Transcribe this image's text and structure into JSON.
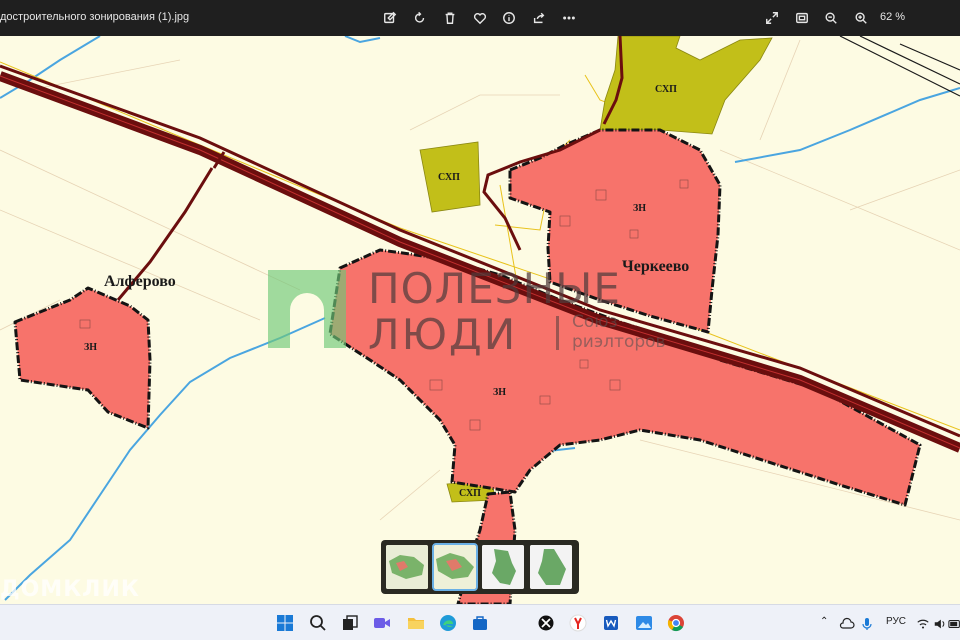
{
  "window": {
    "title": "достроительного зонирования (1).jpg",
    "zoom_level": "62 %"
  },
  "toolbar": {
    "icons": [
      "edit-icon",
      "rotate-icon",
      "delete-icon",
      "favorite-icon",
      "info-icon",
      "share-icon",
      "more-icon"
    ],
    "right_icons": [
      "fullscreen-icon",
      "fit-icon",
      "zoom-out-icon",
      "zoom-in-icon"
    ]
  },
  "map": {
    "villages": [
      "Алферово",
      "Черкеево"
    ],
    "zone_label": "ЗН",
    "agri_label": "СХП",
    "colors": {
      "zone_fill": "#f7736b",
      "agri_fill": "#c2bf19",
      "road": "#6b0e0e",
      "river": "#4aa5e0",
      "background": "#fdfbe3"
    }
  },
  "watermark": {
    "line1": "ПОЛЕЗНЫЕ",
    "line2": "ЛЮДИ",
    "sub1": "Союз",
    "sub2": "риэлторов",
    "corner": "ДОМКЛИК"
  },
  "filmstrip": {
    "count_visible": 4,
    "selected_index": 1
  },
  "taskbar": {
    "apps": [
      "windows-start",
      "search",
      "task-view",
      "meet",
      "file-explorer",
      "edge",
      "store",
      "xbox",
      "yandex",
      "word",
      "photos",
      "chrome"
    ],
    "tray_lang": "РУС"
  }
}
